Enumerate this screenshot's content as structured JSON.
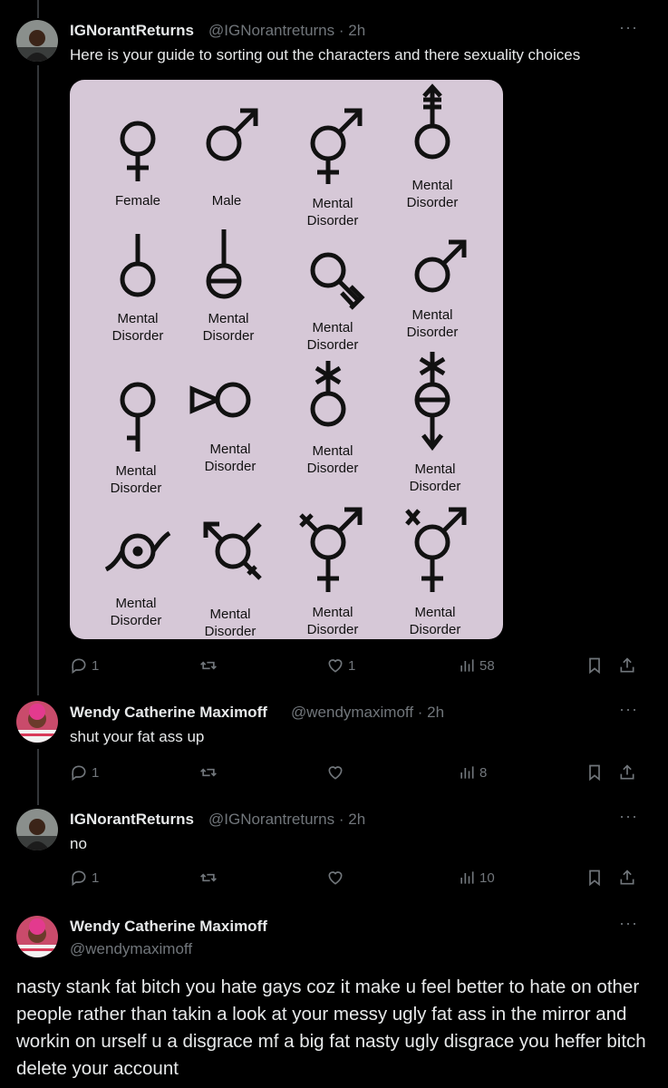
{
  "tweets": [
    {
      "name": "IGNorantReturns",
      "handle": "@IGNorantreturns",
      "time": "2h",
      "text": "Here is your guide to sorting out the characters and there sexuality choices",
      "replies": "1",
      "retweets": "",
      "likes": "1",
      "views": "58"
    },
    {
      "name": "Wendy Catherine Maximoff",
      "handle": "@wendymaximoff",
      "time": "2h",
      "text": "shut your fat ass up",
      "replies": "1",
      "retweets": "",
      "likes": "",
      "views": "8"
    },
    {
      "name": "IGNorantReturns",
      "handle": "@IGNorantreturns",
      "time": "2h",
      "text": "no",
      "replies": "1",
      "retweets": "",
      "likes": "",
      "views": "10"
    }
  ],
  "main_tweet": {
    "name": "Wendy Catherine Maximoff",
    "handle": "@wendymaximoff",
    "text": "nasty stank fat bitch you hate gays coz it make u feel better to hate on other people rather than takin a look at your messy ugly fat ass in the mirror and workin on urself u a disgrace mf a big fat nasty ugly disgrace you heffer bitch delete your account"
  },
  "image_labels": {
    "female": "Female",
    "male": "Male",
    "mental1": "Mental",
    "mental2": "Disorder"
  },
  "icons": [
    "reply-icon",
    "retweet-icon",
    "like-icon",
    "views-icon",
    "bookmark-icon",
    "share-icon",
    "more-icon"
  ]
}
